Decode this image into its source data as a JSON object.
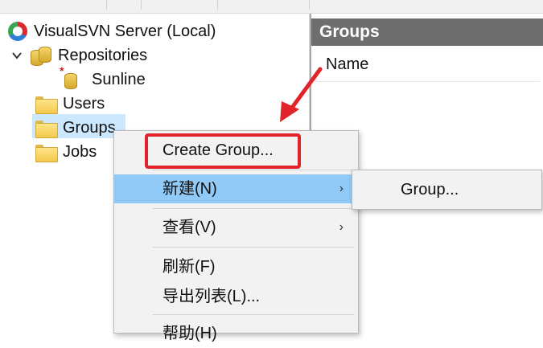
{
  "tree": {
    "root_label": "VisualSVN Server (Local)",
    "repositories_label": "Repositories",
    "repo_items": [
      "Sunline"
    ],
    "users_label": "Users",
    "groups_label": "Groups",
    "jobs_label": "Jobs"
  },
  "right_pane": {
    "header": "Groups",
    "column_name": "Name"
  },
  "context_menu": {
    "items": [
      {
        "label": "Create Group..."
      },
      {
        "label": "新建(N)",
        "has_submenu": true
      },
      {
        "label": "查看(V)",
        "has_submenu": true
      },
      {
        "label": "刷新(F)"
      },
      {
        "label": "导出列表(L)..."
      },
      {
        "label": "帮助(H)"
      }
    ],
    "submenu_arrow": "›"
  },
  "submenu": {
    "items": [
      {
        "label": "Group..."
      }
    ]
  },
  "colors": {
    "menu_hover": "#91c9f7",
    "selection": "#cce8ff",
    "annotation_red": "#e0242a",
    "header_gray": "#6e6e6e"
  }
}
